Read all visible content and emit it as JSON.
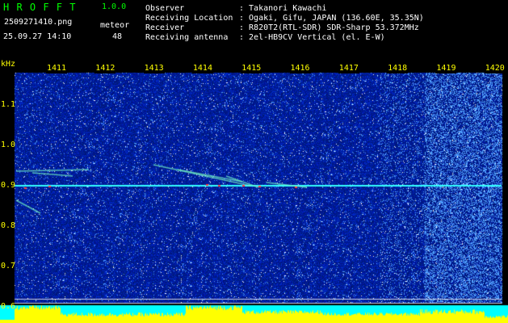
{
  "app": {
    "name": "H R O F F T",
    "version": "1.0.0"
  },
  "file": {
    "name": "2509271410.png",
    "datetime": "25.09.27 14:10"
  },
  "mode": {
    "label": "meteor",
    "count": "48"
  },
  "info": {
    "observer_label": "Observer",
    "observer_value": ": Takanori Kawachi",
    "location_label": "Receiving Location",
    "location_value": ": Ogaki, Gifu, JAPAN (136.60E, 35.35N)",
    "receiver_label": "Receiver",
    "receiver_value": ": R820T2(RTL-SDR) SDR-Sharp 53.372MHz",
    "antenna_label": "Receiving antenna",
    "antenna_value": ": 2el-HB9CV Vertical (el. E-W)"
  },
  "colors": {
    "background": "#000000",
    "text_green": "#00ff00",
    "text_yellow": "#ffff00",
    "text_white": "#ffffff",
    "signal": "#00ffff",
    "level": "#ffff00"
  },
  "chart_data": {
    "type": "heatmap",
    "ylabel": "kHz",
    "x_ticks": [
      "1411",
      "1412",
      "1413",
      "1414",
      "1415",
      "1416",
      "1417",
      "1418",
      "1419",
      "1420"
    ],
    "y_ticks": [
      "1.1",
      "1.0",
      "0.9",
      "0.8",
      "0.7",
      "0.6"
    ],
    "ylim": [
      0.58,
      1.2
    ],
    "carrier_khz": 0.9
  }
}
